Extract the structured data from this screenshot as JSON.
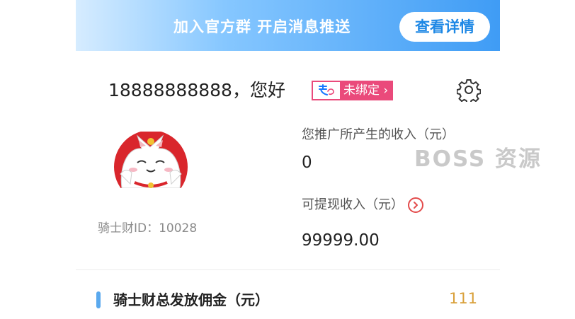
{
  "banner": {
    "text": "加入官方群 开启消息推送",
    "button_label": "查看详情"
  },
  "account": {
    "greeting": "18888888888，您好",
    "bind_status": "未绑定",
    "bind_icon": "alipay-icon",
    "settings_icon": "gear-icon"
  },
  "profile": {
    "avatar_icon": "lucky-cat-avatar",
    "rider_id": "骑士财ID：10028"
  },
  "income": {
    "label": "您推广所产生的收入（元）",
    "value": "0"
  },
  "withdraw": {
    "label": "可提现收入（元）",
    "value": "99999.00",
    "arrow_icon": "chevron-right-circle-icon"
  },
  "watermark": "BOSS 资源",
  "total": {
    "label": "骑士财总发放佣金（元）",
    "value": "111"
  },
  "colors": {
    "accent": "#3f9cf5",
    "badge": "#ea4a7b",
    "amount": "#d9a03a"
  }
}
